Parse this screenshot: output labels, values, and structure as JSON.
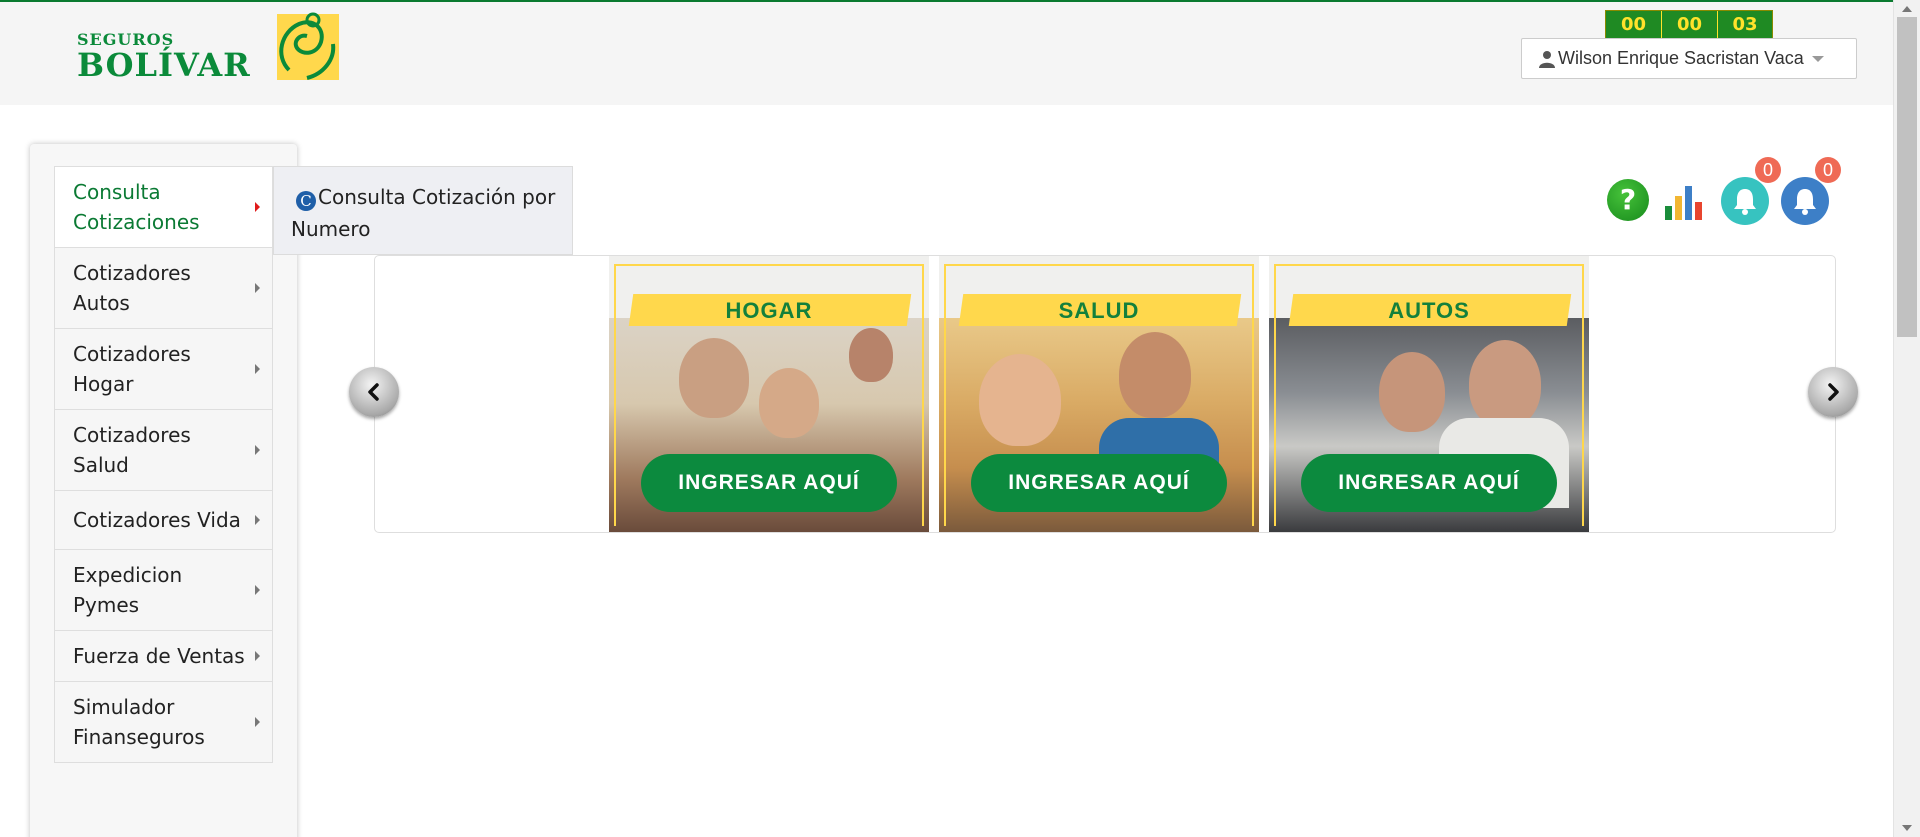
{
  "header": {
    "logo": {
      "top_text": "SEGUROS",
      "brand": "BOLÍVAR"
    },
    "timer": {
      "hours": "00",
      "minutes": "00",
      "seconds": "03"
    },
    "user": {
      "name": "Wilson Enrique Sacristan Vaca"
    }
  },
  "sidebar": {
    "items": [
      {
        "label": "Consulta Cotizaciones",
        "active": true
      },
      {
        "label": "Cotizadores Autos"
      },
      {
        "label": "Cotizadores Hogar"
      },
      {
        "label": "Cotizadores Salud"
      },
      {
        "label": "Cotizadores Vida"
      },
      {
        "label": "Expedicion Pymes"
      },
      {
        "label": "Fuerza de Ventas"
      },
      {
        "label": "Simulador Finanseguros"
      }
    ],
    "submenu": {
      "icon_letter": "C",
      "label": "Consulta Cotización por Numero"
    }
  },
  "actions": {
    "help_glyph": "?",
    "notifications_1_count": "0",
    "notifications_2_count": "0"
  },
  "carousel": {
    "cards": [
      {
        "title": "HOGAR",
        "button": "INGRESAR AQUÍ"
      },
      {
        "title": "SALUD",
        "button": "INGRESAR AQUÍ"
      },
      {
        "title": "AUTOS",
        "button": "INGRESAR AQUÍ"
      }
    ]
  },
  "colors": {
    "brand_green": "#0b8a3a",
    "brand_yellow": "#ffd84c",
    "timer_text": "#ffe22b",
    "badge": "#ef6a55",
    "bell_teal": "#37c3c0",
    "bell_blue": "#3d7fc7"
  }
}
